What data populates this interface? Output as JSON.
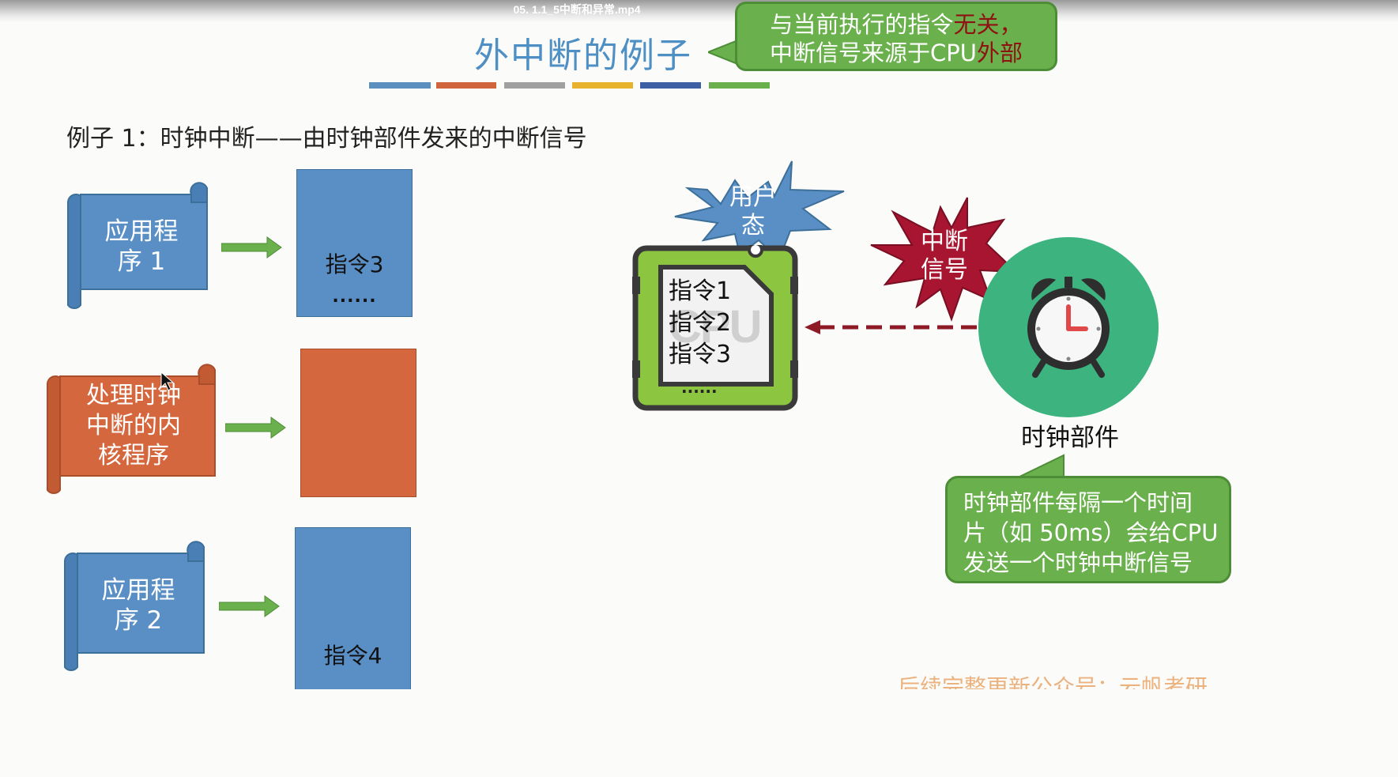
{
  "video": {
    "title": "05. 1.1_5中断和异常.mp4"
  },
  "slide": {
    "title": "外中断的例子",
    "callout_top": {
      "line1_a": "与当前执行的指令",
      "line1_b": "无关，",
      "line2_a": "中断信号来源于CPU",
      "line2_b": "外部"
    },
    "heading": "例子 1：时钟中断——由时钟部件发来的中断信号",
    "strip_colors": [
      "#5a8fc0",
      "#d0643c",
      "#a0a0a0",
      "#e8b32c",
      "#3f5fa5",
      "#6ab04c"
    ],
    "programs": [
      {
        "label_line1": "应用程",
        "label_line2": "序 1",
        "color": "#5a8fc6",
        "block_text": "指令3",
        "block_dots": "......"
      },
      {
        "label_line1": "处理时钟",
        "label_line2": "中断的内",
        "label_line3": "核程序",
        "color": "#d4673d",
        "block_text": "",
        "block_dots": ""
      },
      {
        "label_line1": "应用程",
        "label_line2": "序 2",
        "color": "#5a8fc6",
        "block_text": "指令4",
        "block_dots": ""
      }
    ],
    "cpu": {
      "chip_text": "CPU",
      "lines": [
        "指令1",
        "指令2",
        "指令3"
      ],
      "dots": "......"
    },
    "user_mode_burst": {
      "line1": "用户",
      "line2": "态"
    },
    "interrupt_burst": {
      "line1": "中断",
      "line2": "信号"
    },
    "clock": {
      "label": "时钟部件"
    },
    "callout_bottom": {
      "line1": "时钟部件每隔一个时间",
      "line2": "片（如 50ms）会给CPU",
      "line3": "发送一个时钟中断信号"
    },
    "footer_note": "后续完整更新公众号：云帆考研"
  }
}
